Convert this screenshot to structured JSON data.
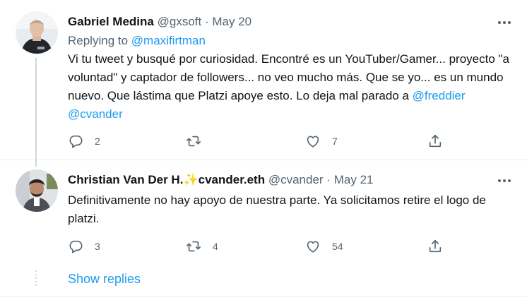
{
  "tweets": [
    {
      "name": "Gabriel Medina",
      "handle": "@gxsoft",
      "separator": "·",
      "date": "May 20",
      "replying_prefix": "Replying to",
      "replying_to": "@maxifirtman",
      "text_main": "Vi tu tweet y busqué por curiosidad. Encontré es un YouTuber/Gamer... proyecto \"a voluntad\" y captador de followers... no veo mucho más. Que se yo... es un mundo nuevo. Que lástima que Platzi apoye esto. Lo deja mal parado a ",
      "mention1": "@freddier",
      "mention2": "@cvander",
      "replies": "2",
      "retweets": "",
      "likes": "7"
    },
    {
      "name": "Christian Van Der H.",
      "name_sparkle": "✨",
      "name_suffix": "cvander.eth",
      "handle": "@cvander",
      "separator": "·",
      "date": "May 21",
      "text": "Definitivamente no hay apoyo de nuestra parte. Ya solicitamos retire el logo de platzi.",
      "replies": "3",
      "retweets": "4",
      "likes": "54"
    }
  ],
  "show_replies": "Show replies",
  "icons": [
    "more-icon",
    "reply-icon",
    "retweet-icon",
    "like-icon",
    "share-icon"
  ],
  "colors": {
    "link": "#1d9bf0",
    "muted": "#536471",
    "text": "#0f1419"
  }
}
